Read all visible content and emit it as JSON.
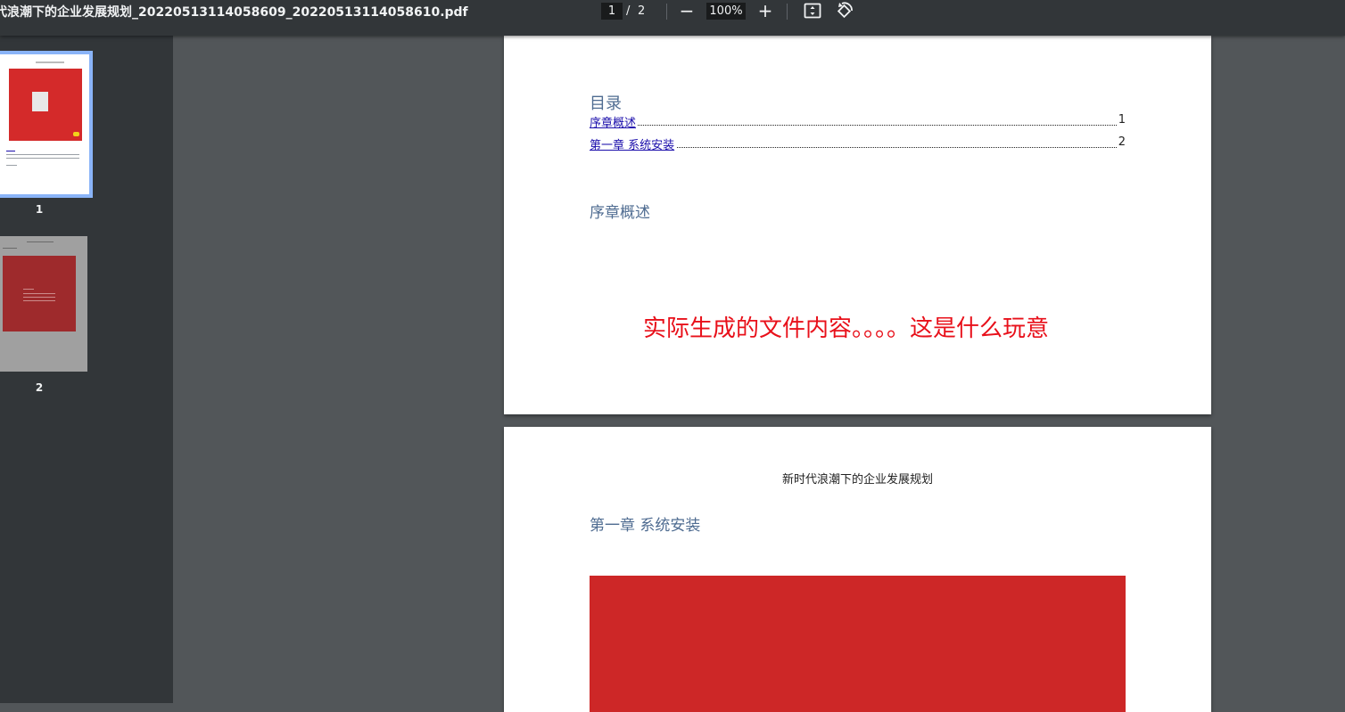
{
  "toolbar": {
    "title": "代浪潮下的企业发展规划_20220513114058609_20220513114058610.pdf",
    "current_page": "1",
    "page_separator": "/",
    "total_pages": "2",
    "zoom_out_label": "−",
    "zoom_level": "100%",
    "zoom_in_label": "+",
    "fit_icon": "fit-to-page-icon",
    "rotate_icon": "rotate-counterclockwise-icon"
  },
  "sidebar": {
    "thumbnails": [
      {
        "label": "1",
        "selected": true
      },
      {
        "label": "2",
        "selected": false
      }
    ]
  },
  "page1": {
    "toc_title": "目录",
    "toc": [
      {
        "text": "序章概述",
        "page": "1"
      },
      {
        "text": "第一章   系统安装",
        "page": "2"
      }
    ],
    "heading": "序章概述",
    "note": "实际生成的文件内容。。。。这是什么玩意"
  },
  "page2": {
    "header": "新时代浪潮下的企业发展规划",
    "heading": "第一章  系统安装"
  },
  "colors": {
    "toolbar_bg": "#323639",
    "viewer_bg": "#525659",
    "heading": "#4f6c91",
    "link": "#1a0dab",
    "note_red": "#e8101a",
    "image_red": "#cd2727",
    "thumb_selected": "#8ab4f8"
  }
}
